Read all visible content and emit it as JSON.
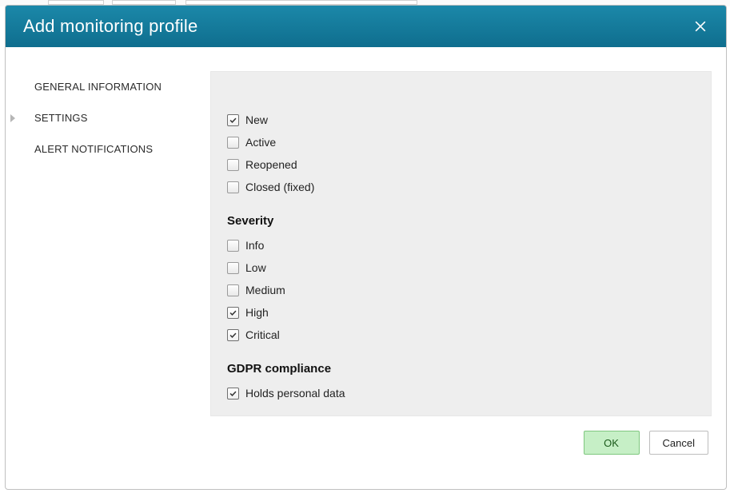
{
  "modal": {
    "title": "Add monitoring profile",
    "close_label": "Close"
  },
  "nav": {
    "items": [
      {
        "label": "GENERAL INFORMATION",
        "active": false
      },
      {
        "label": "SETTINGS",
        "active": true
      },
      {
        "label": "ALERT NOTIFICATIONS",
        "active": false
      }
    ]
  },
  "settings": {
    "status_group": {
      "options": [
        {
          "label": "New",
          "checked": true
        },
        {
          "label": "Active",
          "checked": false
        },
        {
          "label": "Reopened",
          "checked": false
        },
        {
          "label": "Closed (fixed)",
          "checked": false
        }
      ]
    },
    "severity_group": {
      "heading": "Severity",
      "options": [
        {
          "label": "Info",
          "checked": false
        },
        {
          "label": "Low",
          "checked": false
        },
        {
          "label": "Medium",
          "checked": false
        },
        {
          "label": "High",
          "checked": true
        },
        {
          "label": "Critical",
          "checked": true
        }
      ]
    },
    "gdpr_group": {
      "heading": "GDPR compliance",
      "options": [
        {
          "label": "Holds personal data",
          "checked": true
        }
      ]
    }
  },
  "footer": {
    "ok_label": "OK",
    "cancel_label": "Cancel"
  }
}
